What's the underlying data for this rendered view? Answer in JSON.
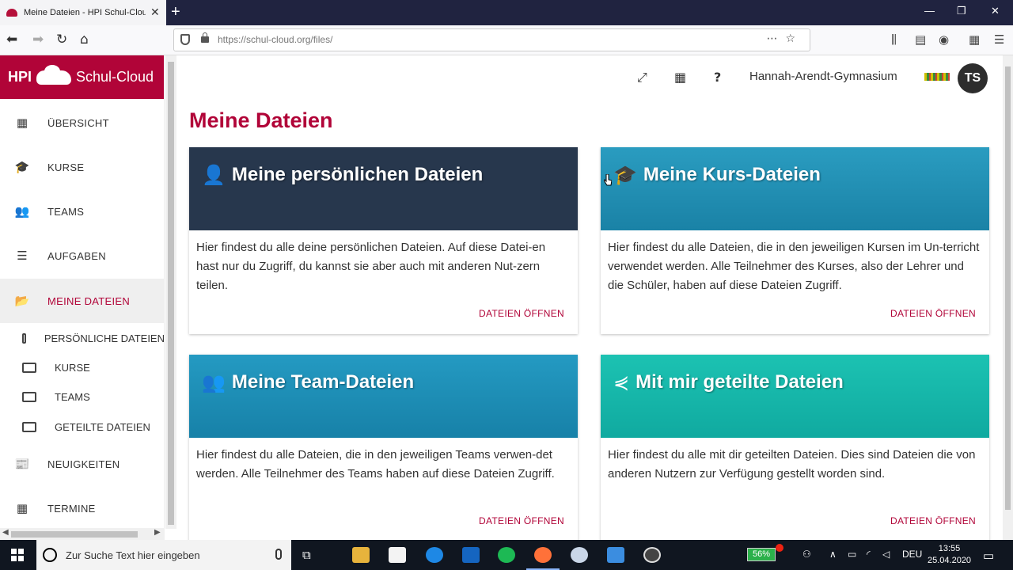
{
  "browser": {
    "tab_title": "Meine Dateien - HPI Schul-Cloud",
    "url": "https://schul-cloud.org/files/"
  },
  "sidebar": {
    "brand_prefix": "HPI",
    "brand_name": "Schul-Cloud",
    "items": [
      {
        "label": "ÜBERSICHT",
        "icon": "dashboard-icon"
      },
      {
        "label": "KURSE",
        "icon": "graduation-cap-icon"
      },
      {
        "label": "TEAMS",
        "icon": "users-icon"
      },
      {
        "label": "AUFGABEN",
        "icon": "tasks-icon"
      },
      {
        "label": "MEINE DATEIEN",
        "icon": "folder-open-icon",
        "active": true
      },
      {
        "label": "NEUIGKEITEN",
        "icon": "newspaper-icon"
      },
      {
        "label": "TERMINE",
        "icon": "calendar-icon"
      }
    ],
    "subitems": [
      {
        "label": "PERSÖNLICHE DATEIEN"
      },
      {
        "label": "KURSE"
      },
      {
        "label": "TEAMS"
      },
      {
        "label": "GETEILTE DATEIEN"
      }
    ]
  },
  "header": {
    "school": "Hannah-Arendt-Gymnasium",
    "avatar_initials": "TS",
    "help": "?"
  },
  "main": {
    "page_title": "Meine Dateien",
    "cards": [
      {
        "title": "Meine persönlichen Dateien",
        "icon": "user-icon",
        "text": "Hier findest du alle deine persönlichen Dateien. Auf diese Datei-en hast nur du Zugriff, du kannst sie aber auch mit anderen Nut-zern teilen.",
        "link": "DATEIEN ÖFFNEN",
        "color": "#27374d"
      },
      {
        "title": "Meine Kurs-Dateien",
        "icon": "graduation-cap-icon",
        "text": "Hier findest du alle Dateien, die in den jeweiligen Kursen im Un-terricht verwendet werden. Alle Teilnehmer des Kurses, also der Lehrer und die Schüler, haben auf diese Dateien Zugriff.",
        "link": "DATEIEN ÖFFNEN",
        "color": "#1f8fb0"
      },
      {
        "title": "Meine Team-Dateien",
        "icon": "users-icon",
        "text": "Hier findest du alle Dateien, die in den jeweiligen Teams verwen-det werden. Alle Teilnehmer des Teams haben auf diese Dateien Zugriff.",
        "link": "DATEIEN ÖFFNEN",
        "color": "#1d88b0"
      },
      {
        "title": "Mit mir geteilte Dateien",
        "icon": "share-icon",
        "text": "Hier findest du alle mit dir geteilten Dateien. Dies sind Dateien die von anderen Nutzern zur Verfügung gestellt worden sind.",
        "link": "DATEIEN ÖFFNEN",
        "color": "#15b4a8"
      }
    ]
  },
  "taskbar": {
    "search_placeholder": "Zur Suche Text hier eingeben",
    "battery": "56%",
    "language": "DEU",
    "time": "13:55",
    "date": "25.04.2020"
  }
}
